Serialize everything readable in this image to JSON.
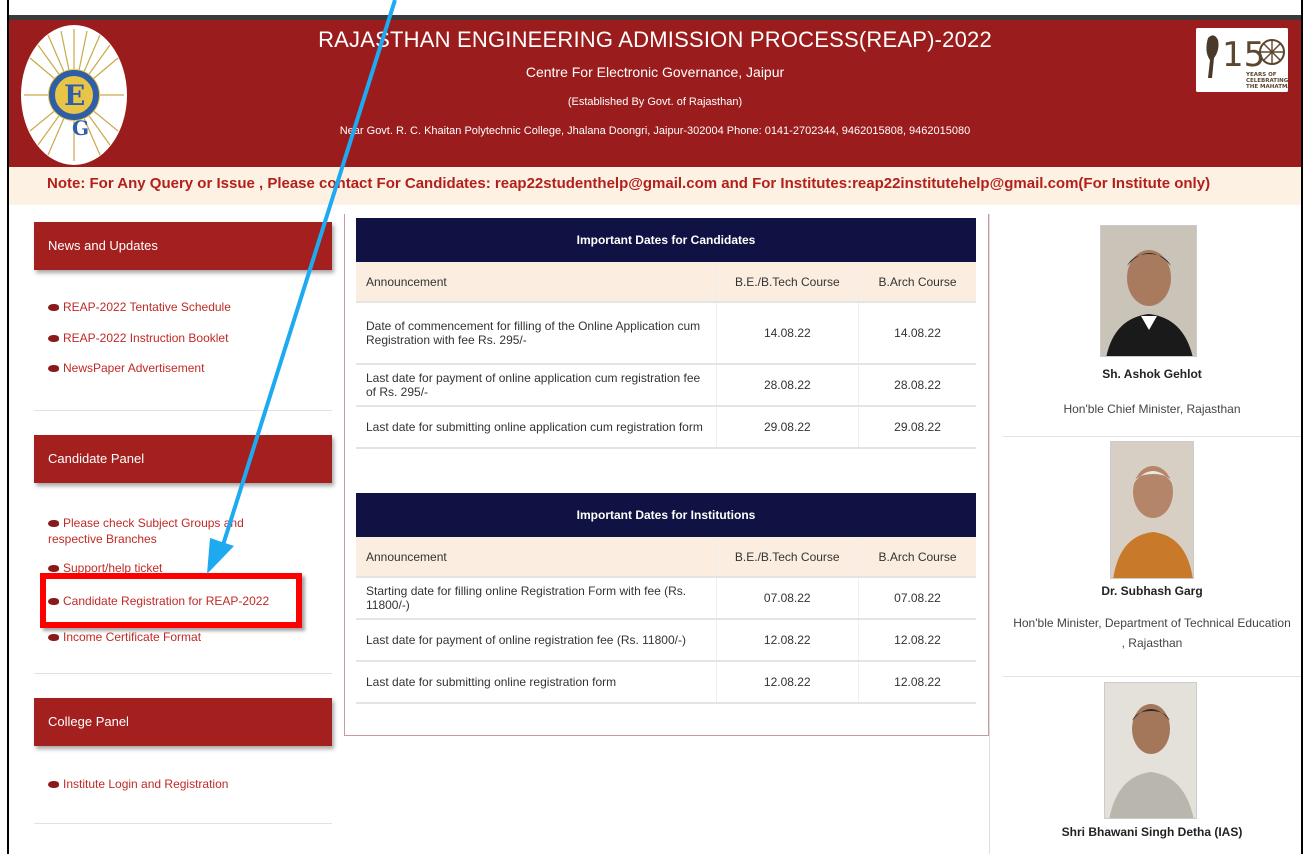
{
  "header": {
    "title": "RAJASTHAN ENGINEERING ADMISSION PROCESS(REAP)-2022",
    "org": "Centre For Electronic Governance, Jaipur",
    "established": "(Established By Govt. of Rajasthan)",
    "address": "Near Govt. R. C. Khaitan Polytechnic College, Jhalana Doongri, Jaipur-302004 Phone: 0141-2702344, 9462015808, 9462015080",
    "logo_right_text": "150 YEARS OF CELEBRATING THE MAHATMA",
    "bg_color": "#9b1c1c"
  },
  "note": "Note: For Any Query or Issue , Please contact For Candidates: reap22studenthelp@gmail.com and For Institutes:reap22institutehelp@gmail.com(For Institute only)",
  "sidebar": {
    "news": {
      "title": "News and Updates",
      "items": [
        "REAP-2022 Tentative Schedule",
        "REAP-2022 Instruction Booklet",
        "NewsPaper Advertisement"
      ]
    },
    "candidate": {
      "title": "Candidate Panel",
      "items": [
        "Please check Subject Groups and respective Branches",
        "Support/help ticket",
        "Candidate Registration for REAP-2022",
        "Income Certificate Format"
      ]
    },
    "college": {
      "title": "College Panel",
      "items": [
        "Institute Login and Registration"
      ]
    }
  },
  "candidates_table": {
    "title": "Important Dates for Candidates",
    "headers": [
      "Announcement",
      "B.E./B.Tech Course",
      "B.Arch Course"
    ],
    "rows": [
      [
        "Date of commencement for filling of the Online Application cum Registration with fee Rs. 295/-",
        "14.08.22",
        "14.08.22"
      ],
      [
        "Last date for payment of online application cum registration fee of Rs. 295/-",
        "28.08.22",
        "28.08.22"
      ],
      [
        "Last date for submitting online application cum registration form",
        "29.08.22",
        "29.08.22"
      ]
    ]
  },
  "institutions_table": {
    "title": "Important Dates for Institutions",
    "headers": [
      "Announcement",
      "B.E./B.Tech Course",
      "B.Arch Course"
    ],
    "rows": [
      [
        "Starting date for filling online Registration Form with fee (Rs. 11800/-)",
        "07.08.22",
        "07.08.22"
      ],
      [
        "Last date for payment of online registration fee (Rs. 11800/-)",
        "12.08.22",
        "12.08.22"
      ],
      [
        "Last date for submitting online registration form",
        "12.08.22",
        "12.08.22"
      ]
    ]
  },
  "people": [
    {
      "name": "Sh. Ashok Gehlot",
      "role": "Hon'ble Chief Minister, Rajasthan"
    },
    {
      "name": "Dr. Subhash Garg",
      "role": "Hon'ble Minister, Department of Technical Education , Rajasthan"
    },
    {
      "name": "Shri Bhawani Singh Detha (IAS)",
      "role": ""
    }
  ],
  "annotation": {
    "arrow_color": "#1eaaf1",
    "box_color": "#ff0000"
  }
}
